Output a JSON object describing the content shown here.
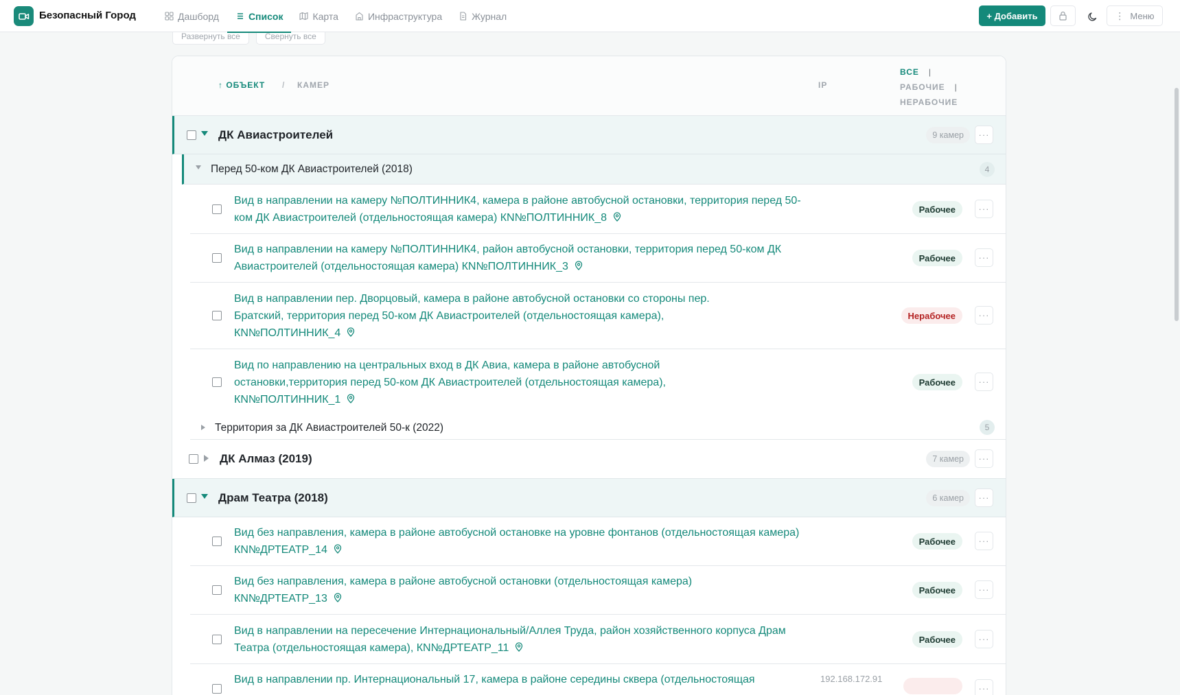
{
  "app": {
    "brand": "Безопасный Город",
    "colors": {
      "accent": "#14897a",
      "ok_bg": "#eaf5f1",
      "bad_text": "#b42323"
    }
  },
  "nav": [
    {
      "label": "Дашборд",
      "icon": "grid-icon",
      "active": false
    },
    {
      "label": "Список",
      "icon": "list-icon",
      "active": true
    },
    {
      "label": "Карта",
      "icon": "map-icon",
      "active": false
    },
    {
      "label": "Инфраструктура",
      "icon": "building-icon",
      "active": false
    },
    {
      "label": "Журнал",
      "icon": "document-icon",
      "active": false
    }
  ],
  "toolbar": {
    "add_label": "+ Добавить",
    "menu_label": "Меню"
  },
  "actions": {
    "expand_all": "Развернуть все",
    "collapse_all": "Свернуть все"
  },
  "table": {
    "col_object": "↑ ОБЪЕКТ",
    "col_slash": "/",
    "col_cameras": "КАМЕР",
    "col_ip": "IP",
    "filter_all": "ВСЕ",
    "filter_working": "РАБОЧИЕ",
    "filter_notworking": "НЕРАБОЧИЕ",
    "more": "···"
  },
  "groups": [
    {
      "title": "ДК Авиастроителей",
      "count": "9 камер",
      "subgroups": [
        {
          "title": "Перед 50-ком ДК Авиастроителей (2018)",
          "count": "4",
          "cameras": [
            {
              "name": "Вид в направлении на камеру №ПОЛТИННИК4, камера в районе автобусной остановки, территория перед 50-ком ДК Авиастроителей (отдельностоящая камера) КN№ПОЛТИННИК_8",
              "status": "Рабочее",
              "ip": ""
            },
            {
              "name": "Вид в направлении на камеру №ПОЛТИННИК4, район автобусной остановки, территория перед 50-ком ДК Авиастроителей (отдельностоящая камера) КN№ПОЛТИННИК_3",
              "status": "Рабочее",
              "ip": ""
            },
            {
              "name": "Вид в направлении пер. Дворцовый, камера в районе автобусной остановки со стороны пер. Братский, территория перед 50-ком ДК Авиастроителей (отдельностоящая камера), КN№ПОЛТИННИК_4",
              "status": "Нерабочее",
              "ip": ""
            },
            {
              "name": "Вид по направлению на центральных вход в ДК Авиа, камера в районе автобусной остановки,территория перед 50-ком ДК Авиастроителей (отдельностоящая камера), КN№ПОЛТИННИК_1",
              "status": "Рабочее",
              "ip": ""
            }
          ]
        },
        {
          "title": "Территория за ДК Авиастроителей 50-к (2022)",
          "count": "5"
        }
      ]
    },
    {
      "title": "ДК Алмаз (2019)",
      "count": "7 камер"
    },
    {
      "title": "Драм Театра (2018)",
      "count": "6 камер",
      "cameras": [
        {
          "name": "Вид без направления, камера в районе автобусной остановке на уровне фонтанов (отдельностоящая камера) КN№ДРТЕАТР_14",
          "status": "Рабочее",
          "ip": ""
        },
        {
          "name": "Вид без направления, камера в районе автобусной остановки (отдельностоящая камера) КN№ДРТЕАТР_13",
          "status": "Рабочее",
          "ip": ""
        },
        {
          "name": "Вид в направлении на пересечение Интернациональный/Аллея Труда, район хозяйственного корпуса Драм Театра (отдельностоящая камера), КN№ДРТЕАТР_11",
          "status": "Рабочее",
          "ip": ""
        },
        {
          "name": "Вид в направлении пр. Интернациональный 17, камера в районе середины сквера (отдельностоящая",
          "status": "",
          "ip": "192.168.172.91"
        }
      ]
    }
  ]
}
